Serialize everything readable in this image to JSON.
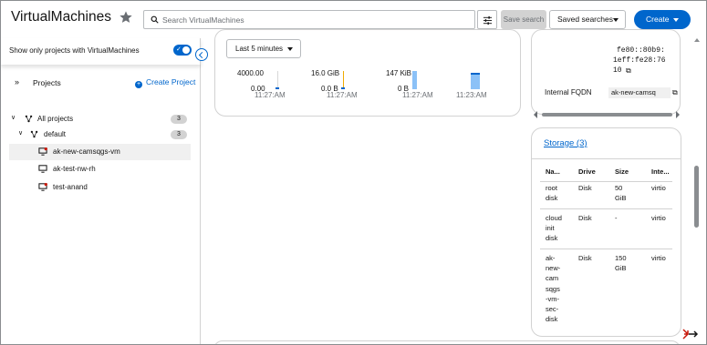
{
  "header": {
    "title": "VirtualMachines",
    "search_placeholder": "Search VirtualMachines",
    "save_search_label": "Save search",
    "saved_searches_label": "Saved searches",
    "create_label": "Create"
  },
  "sidebar": {
    "toggle_label": "Show only projects with VirtualMachines",
    "toggle_on": true,
    "projects_label": "Projects",
    "create_project_label": "Create Project",
    "tree": {
      "all_projects": {
        "label": "All projects",
        "count": "3"
      },
      "default": {
        "label": "default",
        "count": "3"
      },
      "vms": [
        {
          "label": "ak-new-camsqgs-vm",
          "selected": true,
          "status": "stopped"
        },
        {
          "label": "ak-test-nw-rh",
          "selected": false,
          "status": "running"
        },
        {
          "label": "test-anand",
          "selected": false,
          "status": "stopped"
        }
      ]
    }
  },
  "utilization": {
    "time_range": "Last 5 minutes",
    "cpu": {
      "top": "4000.00",
      "bottom": "0.00",
      "time": "11:27:AM"
    },
    "memory": {
      "top": "16.0 GiB",
      "bottom": "0.0 B",
      "time": "11:27:AM"
    },
    "storage": {
      "top": "147 KiB",
      "bottom": "0 B",
      "time": "11:27:AM"
    },
    "network": {
      "time": "11:23:AM",
      "time2": "11:27:AM"
    }
  },
  "network_card": {
    "ipv6": [
      "fe80::80b9:",
      "1eff:fe28:76",
      "10"
    ],
    "fqdn_label": "Internal FQDN",
    "fqdn_value": "ak-new-camsq"
  },
  "storage_card": {
    "link": "Storage (3)",
    "headers": [
      "Na...",
      "Drive",
      "Size",
      "Inte..."
    ],
    "rows": [
      {
        "name": [
          "root",
          "disk"
        ],
        "drive": "Disk",
        "size": [
          "50",
          "GiB"
        ],
        "interface": "virtio"
      },
      {
        "name": [
          "cloud",
          "init",
          "disk"
        ],
        "drive": "Disk",
        "size": [
          "-"
        ],
        "interface": "virtio"
      },
      {
        "name": [
          "ak-",
          "new-",
          "cam",
          "sqgs",
          "-vm-",
          "sec-",
          "disk"
        ],
        "drive": "Disk",
        "size": [
          "150",
          "GiB"
        ],
        "interface": "virtio"
      }
    ]
  },
  "colors": {
    "accent": "#0066cc",
    "chart_fill": "#8bc1f7"
  }
}
